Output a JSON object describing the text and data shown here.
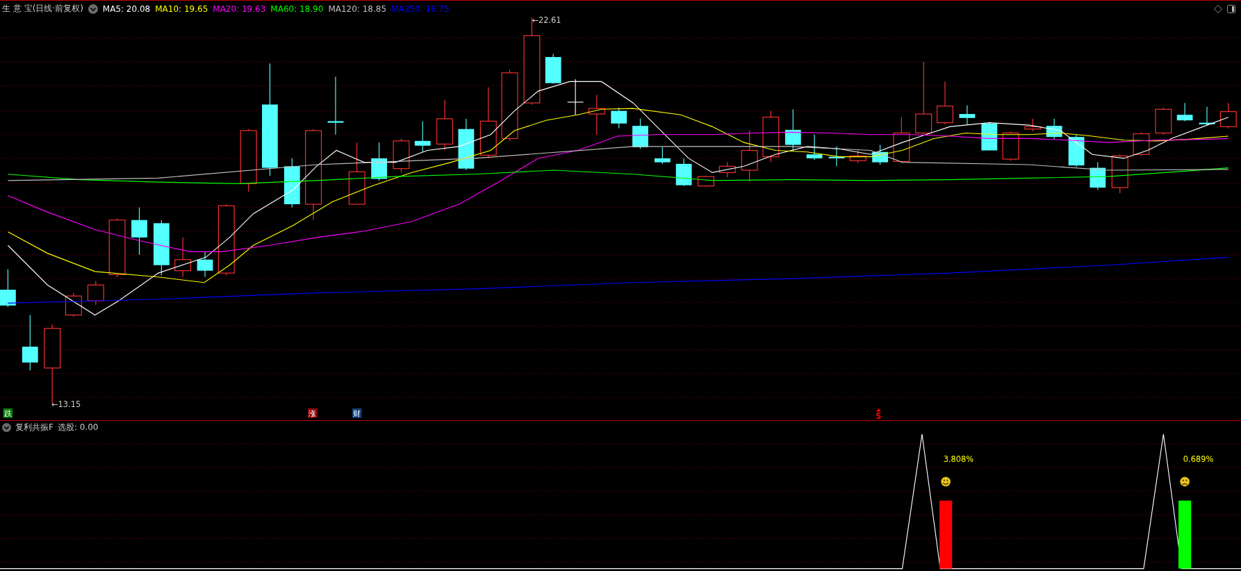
{
  "header": {
    "title": "生 意 宝(日线·前复权)",
    "averages": [
      {
        "label": "MA5:",
        "value": "20.08",
        "color": "#ffffff"
      },
      {
        "label": "MA10:",
        "value": "19.65",
        "color": "#ffff00"
      },
      {
        "label": "MA20:",
        "value": "19.63",
        "color": "#ff00ff"
      },
      {
        "label": "MA60:",
        "value": "18.90",
        "color": "#00ff00"
      },
      {
        "label": "MA120:",
        "value": "18.85",
        "color": "#c0c0c0"
      },
      {
        "label": "MA250:",
        "value": "16.75",
        "color": "#0000ff"
      }
    ]
  },
  "price_chart": {
    "high_label": "←22.61",
    "low_label": "←13.15",
    "markers": [
      {
        "kind": "tag",
        "text": "跌",
        "color": "#007a00"
      },
      {
        "kind": "tag",
        "text": "涨",
        "color": "#8a0000"
      },
      {
        "kind": "tag",
        "text": "财",
        "color": "#123f78"
      },
      {
        "kind": "letter",
        "text": "S",
        "color": "#ff0000"
      }
    ]
  },
  "indicator": {
    "name": "复利共振F",
    "reading_label": "选股:",
    "reading": "0.00",
    "signals": [
      {
        "label": "3.808%",
        "kind": "happy",
        "color": "#ff0000"
      },
      {
        "label": "0.689%",
        "kind": "sad",
        "color": "#00ff00"
      }
    ]
  }
}
